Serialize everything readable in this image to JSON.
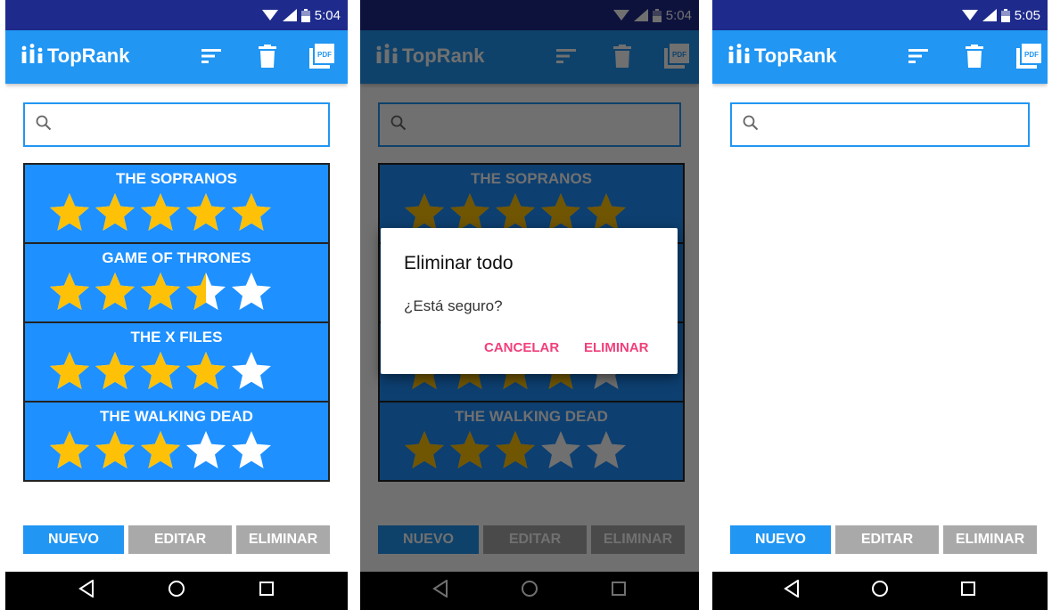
{
  "app": {
    "title": "TopRank"
  },
  "colors": {
    "primary": "#2196f3",
    "status_bar": "#1e2b8c",
    "star_filled": "#ffc107",
    "star_empty": "#ffffff",
    "accent": "#f0407a"
  },
  "icons": {
    "brand": "bar-chart-icon",
    "sort": "sort-icon",
    "delete": "trash-icon",
    "pdf": "pdf-icon",
    "search": "search-icon",
    "nav": [
      "back-icon",
      "home-icon",
      "recents-icon"
    ]
  },
  "pdf_icon_label": "PDF",
  "screens": [
    {
      "time": "5:04"
    },
    {
      "time": "5:04"
    },
    {
      "time": "5:05"
    }
  ],
  "search": {
    "placeholder": ""
  },
  "series": [
    {
      "name": "THE SOPRANOS",
      "rating": 5
    },
    {
      "name": "GAME OF THRONES",
      "rating": 3.5
    },
    {
      "name": "THE X FILES",
      "rating": 4
    },
    {
      "name": "THE WALKING DEAD",
      "rating": 3
    }
  ],
  "buttons": {
    "new": "NUEVO",
    "edit": "EDITAR",
    "delete": "ELIMINAR"
  },
  "dialog": {
    "title": "Eliminar todo",
    "message": "¿Está seguro?",
    "cancel": "CANCELAR",
    "confirm": "ELIMINAR"
  }
}
